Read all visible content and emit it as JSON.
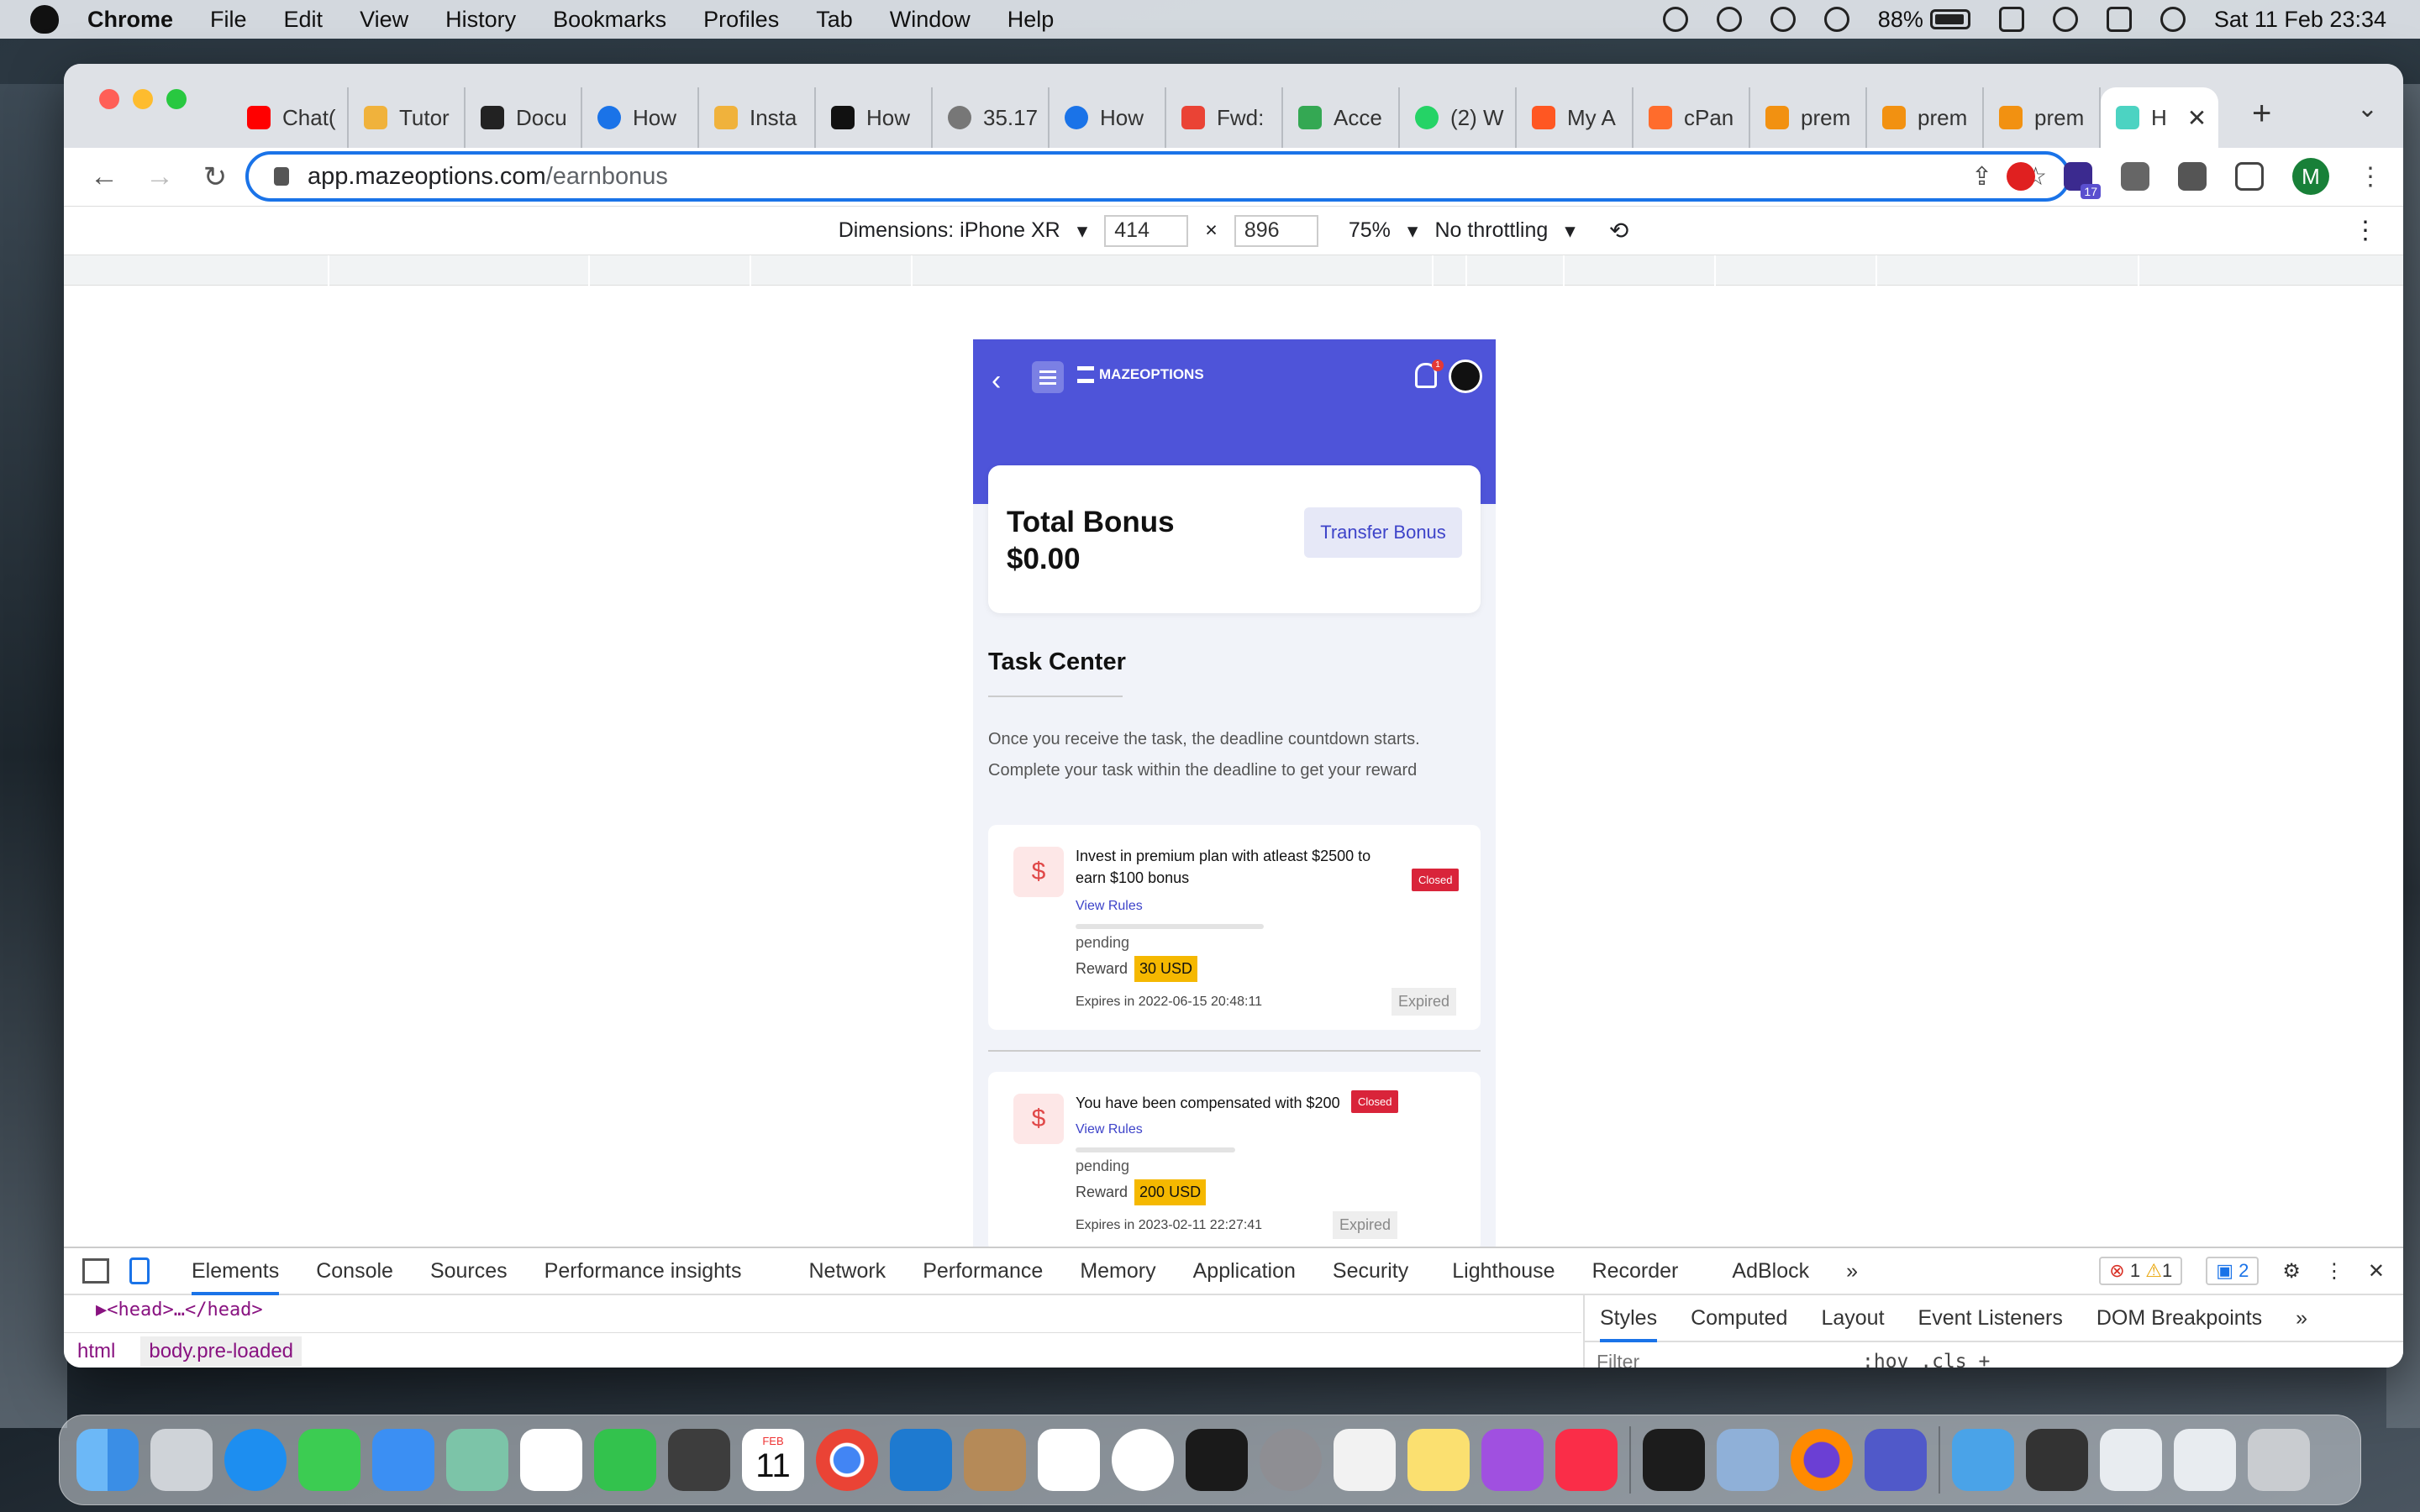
{
  "menubar": {
    "app": "Chrome",
    "items": [
      "File",
      "Edit",
      "View",
      "History",
      "Bookmarks",
      "Profiles",
      "Tab",
      "Window",
      "Help"
    ],
    "battery": "88%",
    "datetime": "Sat 11 Feb  23:34"
  },
  "tabs": [
    {
      "label": "Chat(",
      "color": "#ff0000"
    },
    {
      "label": "Tutor",
      "color": "#f0b23c"
    },
    {
      "label": "Docu",
      "color": "#222222"
    },
    {
      "label": "How",
      "color": "#1a73e8"
    },
    {
      "label": "Insta",
      "color": "#f0b23c"
    },
    {
      "label": "How",
      "color": "#111111"
    },
    {
      "label": "35.17",
      "color": "#777777"
    },
    {
      "label": "How",
      "color": "#1a73e8"
    },
    {
      "label": "Fwd:",
      "color": "#ea4335"
    },
    {
      "label": "Acce",
      "color": "#34a853"
    },
    {
      "label": "(2) W",
      "color": "#25d366"
    },
    {
      "label": "My A",
      "color": "#ff5722"
    },
    {
      "label": "cPan",
      "color": "#ff6c2c"
    },
    {
      "label": "prem",
      "color": "#f29111"
    },
    {
      "label": "prem",
      "color": "#f29111"
    },
    {
      "label": "prem",
      "color": "#f29111"
    }
  ],
  "active_tab": {
    "label": "H",
    "color": "#4cd3c2"
  },
  "address": {
    "host": "app.mazeoptions.com",
    "path": "/earnbonus"
  },
  "extensions_badge": "17",
  "profile_initial": "M",
  "device_toolbar": {
    "dimensions": "Dimensions: iPhone XR",
    "width": "414",
    "times": "×",
    "height": "896",
    "zoom": "75%",
    "throttling": "No throttling"
  },
  "phone": {
    "logo": "MAZEOPTIONS",
    "bell_count": "1",
    "total_bonus_label": "Total Bonus",
    "total_bonus_value": "$0.00",
    "transfer_button": "Transfer Bonus",
    "task_center_title": "Task Center",
    "task_center_desc": "Once you receive the task, the deadline countdown starts. Complete your task within the deadline to get your reward",
    "tasks": [
      {
        "title": "Invest in premium plan with atleast $2500 to earn $100 bonus",
        "status_badge": "Closed",
        "rules_link": "View Rules",
        "progress_status": "pending",
        "reward_label": "Reward",
        "reward_value": "30 USD",
        "expires": "Expires in 2022-06-15 20:48:11",
        "state": "Expired"
      },
      {
        "title": "You have been compensated with $200",
        "status_badge": "Closed",
        "rules_link": "View Rules",
        "progress_status": "pending",
        "reward_label": "Reward",
        "reward_value": "200 USD",
        "expires": "Expires in 2023-02-11 22:27:41",
        "state": "Expired"
      }
    ]
  },
  "devtools": {
    "tabs": [
      "Elements",
      "Console",
      "Sources",
      "Performance insights",
      "Network",
      "Performance",
      "Memory",
      "Application",
      "Security",
      "Lighthouse",
      "Recorder",
      "AdBlock"
    ],
    "errors": "1",
    "warnings": "1",
    "messages": "2",
    "code_line": "▶<head>…</head>",
    "breadcrumb_1": "html",
    "breadcrumb_2": "body.pre-loaded",
    "side_tabs": [
      "Styles",
      "Computed",
      "Layout",
      "Event Listeners",
      "DOM Breakpoints"
    ],
    "filter_placeholder": "Filter",
    "filter_buttons": ":hov  .cls  +"
  },
  "dock": {
    "calendar_month": "FEB",
    "calendar_day": "11"
  }
}
